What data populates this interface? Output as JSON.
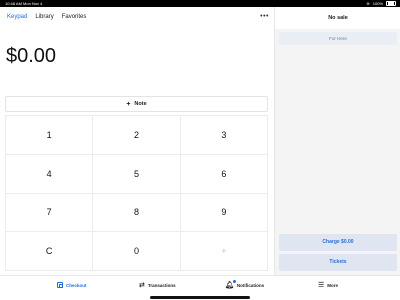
{
  "status_bar": {
    "time_date": "10:48 AM  Mon Nov 4",
    "battery": "100%"
  },
  "tabs": [
    {
      "label": "Keypad",
      "active": true
    },
    {
      "label": "Library",
      "active": false
    },
    {
      "label": "Favorites",
      "active": false
    }
  ],
  "more_icon": "ellipsis-icon",
  "amount": "$0.00",
  "note_label": "Note",
  "keypad": {
    "keys": [
      "1",
      "2",
      "3",
      "4",
      "5",
      "6",
      "7",
      "8",
      "9",
      "C",
      "0",
      "+"
    ]
  },
  "sale_panel": {
    "title": "No sale",
    "dining_option": "For Here",
    "charge_label": "Charge $0.00",
    "tickets_label": "Tickets"
  },
  "bottom_nav": [
    {
      "label": "Checkout",
      "icon": "grid-icon",
      "active": true
    },
    {
      "label": "Transactions",
      "icon": "arrows-icon",
      "active": false
    },
    {
      "label": "Notifications",
      "icon": "bell-icon",
      "active": false
    },
    {
      "label": "More",
      "icon": "menu-icon",
      "active": false
    }
  ],
  "colors": {
    "accent": "#1b6fd9",
    "button_bg": "#dfe6f2",
    "panel_bg": "#f4f4f4"
  }
}
